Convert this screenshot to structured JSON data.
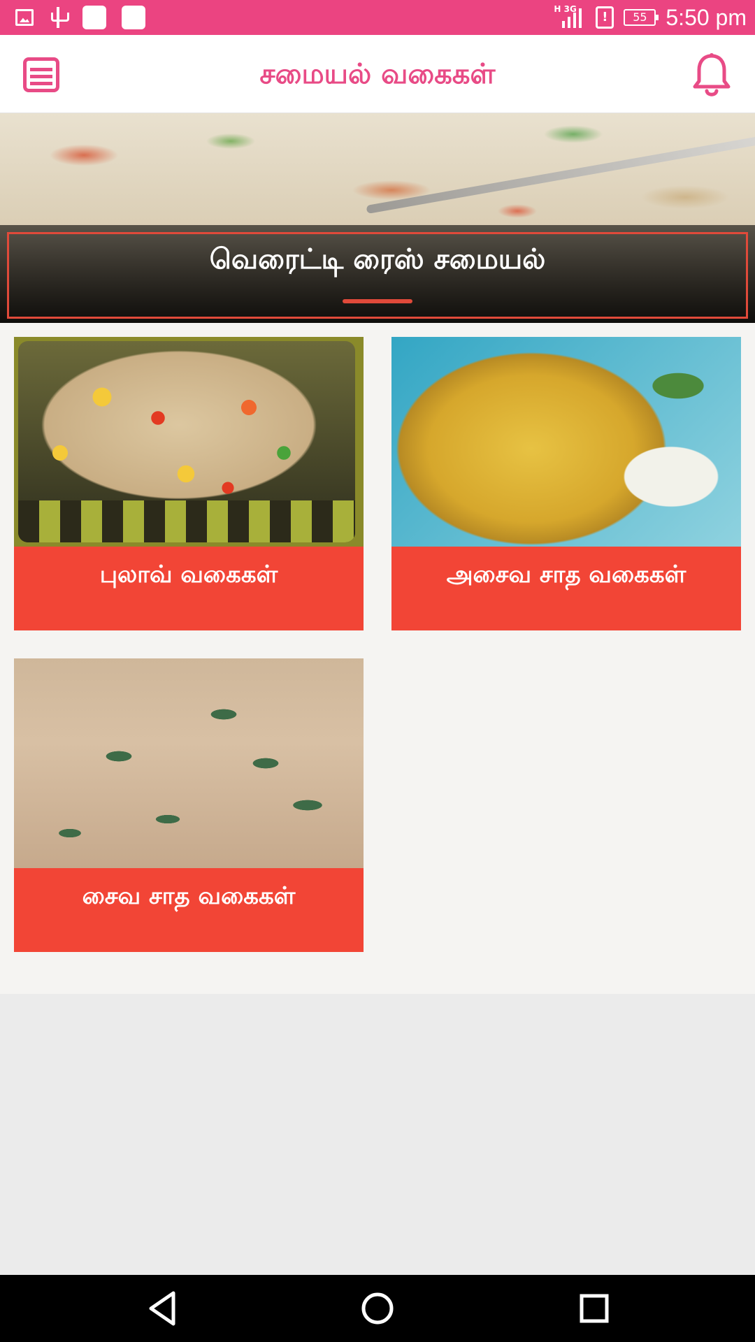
{
  "status_bar": {
    "time": "5:50 pm",
    "battery": "55",
    "network": "H 3G",
    "alert_symbol": "!",
    "icons": [
      "image-icon",
      "usb-icon",
      "notification-square-icon",
      "notification-square-icon",
      "signal-icon",
      "alert-icon",
      "battery-icon"
    ]
  },
  "app_bar": {
    "title": "சமையல் வகைகள்",
    "menu_icon": "menu-list-icon",
    "bell_icon": "bell-icon",
    "accent": "#e84b86"
  },
  "banner": {
    "title": "வெரைட்டி ரைஸ் சமையல்",
    "accent": "#e04a3a"
  },
  "categories": [
    {
      "label": "புலாவ் வகைகள்"
    },
    {
      "label": "அசைவ சாத வகைகள்"
    },
    {
      "label": "சைவ சாத வகைகள்"
    }
  ],
  "colors": {
    "status_bar": "#eb4481",
    "card_label": "#f24536",
    "content_bg": "#f5f4f2"
  },
  "nav_bar": {
    "icons": [
      "back-icon",
      "home-icon",
      "recents-icon"
    ]
  }
}
